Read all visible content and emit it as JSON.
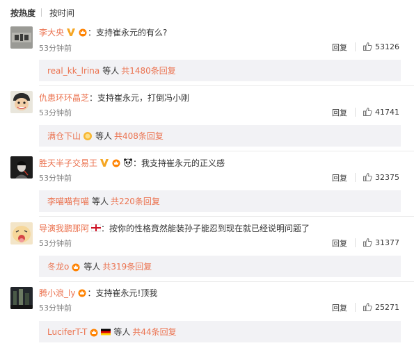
{
  "sort": {
    "hot": "按热度",
    "time": "按时间"
  },
  "comments": [
    {
      "username": "李大央",
      "colon": "：",
      "text": "支持崔永元的有么?",
      "time": "53分钟前",
      "reply": "回复",
      "likes": "53126",
      "sub_user": "real_kk_lrina",
      "sub_mid": "等人",
      "sub_total": "共1480条回复"
    },
    {
      "username": "仇患环环晶芝",
      "colon": "：",
      "text": "支持崔永元，打倒冯小刚",
      "time": "53分钟前",
      "reply": "回复",
      "likes": "41741",
      "sub_user": "满仓下山",
      "sub_mid": "等人",
      "sub_total": "共408条回复"
    },
    {
      "username": "胜天半子交易王",
      "colon": "：",
      "text": "我支持崔永元的正义感",
      "time": "53分钟前",
      "reply": "回复",
      "likes": "32375",
      "sub_user": "李喵喵有喵",
      "sub_mid": "等人",
      "sub_total": "共220条回复"
    },
    {
      "username": "导演我鹏那阿",
      "colon": "：",
      "text": "按你的性格竟然能装孙子能忍到现在就已经说明问题了",
      "time": "53分钟前",
      "reply": "回复",
      "likes": "31377",
      "sub_user": "冬龙o",
      "sub_mid": "等人",
      "sub_total": "共319条回复"
    },
    {
      "username": "腾小浪_ly",
      "colon": "：",
      "text": "支持崔永元!顶我",
      "time": "53分钟前",
      "reply": "回复",
      "likes": "25271",
      "sub_user": "LuciferT-T",
      "sub_mid": "等人",
      "sub_total": "共44条回复"
    }
  ],
  "colors": {
    "accent": "#eb7350",
    "subbox_bg": "#f2f2f5",
    "text": "#333333",
    "meta": "#808080"
  }
}
